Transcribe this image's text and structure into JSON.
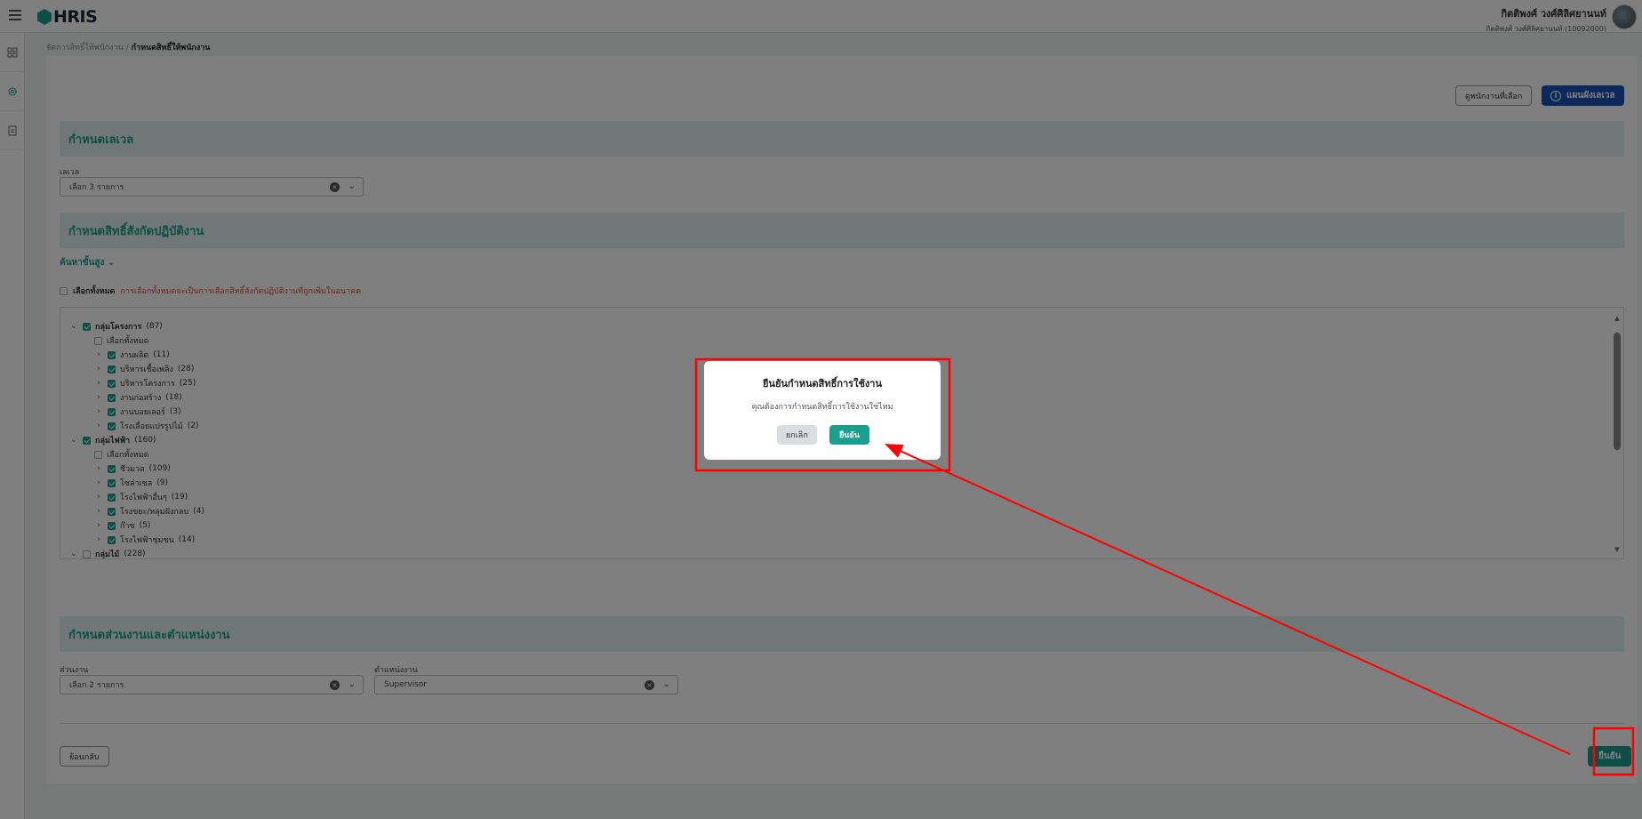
{
  "app": {
    "logo": "HRIS"
  },
  "user": {
    "name": "กิตติพงศ์ วงศ์ศิลิศยานนท์",
    "sub": "กิตติพงศ์ วงศ์ศิลิศยานนท์ (10092000)"
  },
  "breadcrumb": {
    "parent": "จัดการสิทธิ์ให้พนักงาน",
    "separator": " / ",
    "current": "กำหนดสิทธิ์ให้พนักงาน"
  },
  "actions": {
    "view_selected": "ดูพนักงานที่เลือก",
    "level_plan": "แผนผังเลเวล"
  },
  "level_section": {
    "title": "กำหนดเลเวล",
    "label": "เลเวล",
    "value": "เลือก 3 รายการ"
  },
  "unit_section": {
    "title": "กำหนดสิทธิ์สังกัดปฏิบัติงาน",
    "advanced_search": "ค้นหาขั้นสูง",
    "select_all": "เลือกทั้งหมด",
    "select_all_note": "การเลือกทั้งหมดจะเป็นการเลือกสิทธิ์สังกัดปฏิบัติงานที่ถูกเพิ่มในอนาคต",
    "tree": [
      {
        "label": "กลุ่มโครงการ",
        "count": "(87)"
      },
      {
        "label": "เลือกทั้งหมด",
        "count": ""
      },
      {
        "label": "งานผลิต",
        "count": "(11)"
      },
      {
        "label": "บริหารเชื้อเพลิง",
        "count": "(28)"
      },
      {
        "label": "บริหารโครงการ",
        "count": "(25)"
      },
      {
        "label": "งานก่อสร้าง",
        "count": "(18)"
      },
      {
        "label": "งานบอยเลอร์",
        "count": "(3)"
      },
      {
        "label": "โรงเลื่อยแปรรูปไม้",
        "count": "(2)"
      },
      {
        "label": "กลุ่มไฟฟ้า",
        "count": "(160)"
      },
      {
        "label": "เลือกทั้งหมด",
        "count": ""
      },
      {
        "label": "ชีวมวล",
        "count": "(109)"
      },
      {
        "label": "โซล่าเซล",
        "count": "(9)"
      },
      {
        "label": "โรงไฟฟ้าอื่นๆ",
        "count": "(19)"
      },
      {
        "label": "โรงขยะ/หลุมฝังกลบ",
        "count": "(4)"
      },
      {
        "label": "ก๊าซ",
        "count": "(5)"
      },
      {
        "label": "โรงไฟฟ้าชุมชน",
        "count": "(14)"
      },
      {
        "label": "กลุ่มไม้",
        "count": "(228)"
      }
    ]
  },
  "position_section": {
    "title": "กำหนดส่วนงานและตำแหน่งงาน",
    "dept_label": "ส่วนงาน",
    "dept_value": "เลือก 2 รายการ",
    "pos_label": "ตำแหน่งงาน",
    "pos_value": "Supervisor"
  },
  "footer": {
    "back": "ย้อนกลับ",
    "confirm": "ยืนยัน"
  },
  "modal": {
    "title": "ยืนยันกำหนดสิทธิ์การใช้งาน",
    "message": "คุณต้องการกำหนดสิทธิ์การใช้งานใช่ไหม",
    "cancel": "ยกเลิก",
    "confirm": "ยืนยัน"
  },
  "colors": {
    "accent": "#1a9e8e",
    "primary": "#1b52b6",
    "annotation": "#ff0000"
  }
}
